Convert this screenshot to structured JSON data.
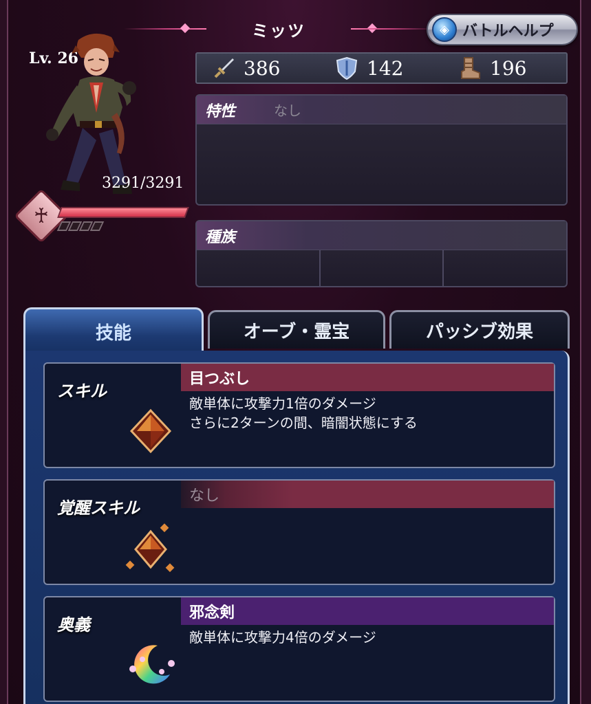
{
  "header": {
    "character_name": "ミッツ",
    "help_button_label": "バトルヘルプ"
  },
  "character": {
    "level": "Lv. 26",
    "hp": "3291/3291",
    "hp_fraction": 1.0
  },
  "stats": {
    "attack": "386",
    "defense": "142",
    "speed": "196"
  },
  "traits": {
    "title": "特性",
    "value": "なし"
  },
  "race": {
    "title": "種族"
  },
  "tabs": [
    {
      "label": "技能",
      "active": true
    },
    {
      "label": "オーブ・霊宝",
      "active": false
    },
    {
      "label": "パッシブ効果",
      "active": false
    }
  ],
  "skills": [
    {
      "type": "スキル",
      "name": "目つぶし",
      "desc_line1": "敵単体に攻撃力1倍のダメージ",
      "desc_line2": "さらに2ターンの間、暗闇状態にする",
      "bar_color": "#7a2c44"
    },
    {
      "type": "覚醒スキル",
      "name": "なし",
      "desc_line1": "",
      "desc_line2": "",
      "bar_color": "#7a2c44"
    },
    {
      "type": "奥義",
      "name": "邪念剣",
      "desc_line1": "敵単体に攻撃力4倍のダメージ",
      "desc_line2": "",
      "bar_color": "#4b2170"
    }
  ],
  "colors": {
    "hp_bar": "#d2334a",
    "active_tab": "#1d3a72",
    "skill_bar": "#7a2c44",
    "ougi_bar": "#4b2170"
  }
}
